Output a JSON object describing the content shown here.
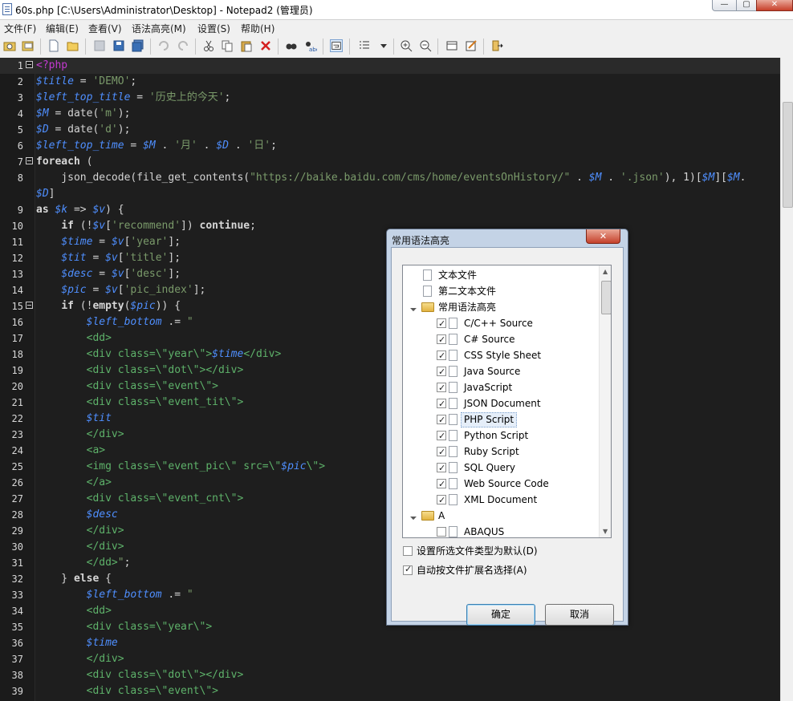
{
  "window": {
    "title": "60s.php [C:\\Users\\Administrator\\Desktop] - Notepad2 (管理员)",
    "min_glyph": "—",
    "max_glyph": "▢",
    "close_glyph": "✕"
  },
  "menu": [
    "文件(F)",
    "编辑(E)",
    "查看(V)",
    "语法高亮(M)",
    "设置(S)",
    "帮助(H)"
  ],
  "dialog": {
    "title": "常用语法高亮",
    "close_glyph": "✕",
    "tree": [
      {
        "label": "文本文件",
        "level": 0,
        "type": "doc"
      },
      {
        "label": "第二文本文件",
        "level": 0,
        "type": "doc"
      },
      {
        "label": "常用语法高亮",
        "level": 0,
        "type": "folder"
      },
      {
        "label": "C/C++ Source",
        "level": 1,
        "checked": true
      },
      {
        "label": "C# Source",
        "level": 1,
        "checked": true
      },
      {
        "label": "CSS Style Sheet",
        "level": 1,
        "checked": true
      },
      {
        "label": "Java Source",
        "level": 1,
        "checked": true
      },
      {
        "label": "JavaScript",
        "level": 1,
        "checked": true
      },
      {
        "label": "JSON Document",
        "level": 1,
        "checked": true
      },
      {
        "label": "PHP Script",
        "level": 1,
        "checked": true,
        "selected": true
      },
      {
        "label": "Python Script",
        "level": 1,
        "checked": true
      },
      {
        "label": "Ruby Script",
        "level": 1,
        "checked": true
      },
      {
        "label": "SQL Query",
        "level": 1,
        "checked": true
      },
      {
        "label": "Web Source Code",
        "level": 1,
        "checked": true
      },
      {
        "label": "XML Document",
        "level": 1,
        "checked": true
      },
      {
        "label": "A",
        "level": 0,
        "type": "folder"
      },
      {
        "label": "ABAQUS",
        "level": 1,
        "checked": false
      }
    ],
    "option_default": {
      "label": "设置所选文件类型为默认(D)",
      "checked": false
    },
    "option_auto": {
      "label": "自动按文件扩展名选择(A)",
      "checked": true
    },
    "ok_label": "确定",
    "cancel_label": "取消"
  },
  "code_lines": [
    {
      "n": "1",
      "html": "<span class='p'>&lt;?php</span>"
    },
    {
      "n": "2",
      "html": "<span class='v'>$title</span> = <span class='s'>'DEMO'</span>;"
    },
    {
      "n": "3",
      "html": "<span class='v'>$left_top_title</span> = <span class='s'>'历史上的今天'</span>;"
    },
    {
      "n": "4",
      "html": "<span class='v'>$M</span> = date(<span class='s'>'m'</span>);"
    },
    {
      "n": "5",
      "html": "<span class='v'>$D</span> = date(<span class='s'>'d'</span>);"
    },
    {
      "n": "6",
      "html": "<span class='v'>$left_top_time</span> = <span class='v'>$M</span> . <span class='s'>'月'</span> . <span class='v'>$D</span> . <span class='s'>'日'</span>;"
    },
    {
      "n": "7",
      "html": "<span class='k'>foreach</span> ("
    },
    {
      "n": "8",
      "html": "    json_decode(file_get_contents(<span class='s'>\"https://baike.baidu.com/cms/home/eventsOnHistory/\"</span> . <span class='v'>$M</span> . <span class='s'>'.json'</span>), 1)[<span class='v'>$M</span>][<span class='v'>$M</span>."
    },
    {
      "n": "",
      "html": "<span class='v'>$D</span>]"
    },
    {
      "n": "9",
      "html": "<span class='k'>as</span> <span class='v'>$k</span> =&gt; <span class='v'>$v</span>) {"
    },
    {
      "n": "10",
      "html": "    <span class='k'>if</span> (!<span class='v'>$v</span>[<span class='s'>'recommend'</span>]) <span class='k'>continue</span>;"
    },
    {
      "n": "11",
      "html": "    <span class='v'>$time</span> = <span class='v'>$v</span>[<span class='s'>'year'</span>];"
    },
    {
      "n": "12",
      "html": "    <span class='v'>$tit</span> = <span class='v'>$v</span>[<span class='s'>'title'</span>];"
    },
    {
      "n": "13",
      "html": "    <span class='v'>$desc</span> = <span class='v'>$v</span>[<span class='s'>'desc'</span>];"
    },
    {
      "n": "14",
      "html": "    <span class='v'>$pic</span> = <span class='v'>$v</span>[<span class='s'>'pic_index'</span>];"
    },
    {
      "n": "15",
      "html": "    <span class='k'>if</span> (!<span class='k'>empty</span>(<span class='v'>$pic</span>)) {"
    },
    {
      "n": "16",
      "html": "        <span class='v'>$left_bottom</span> .= <span class='s'>\"</span>"
    },
    {
      "n": "17",
      "html": "        <span class='h'>&lt;dd&gt;</span>"
    },
    {
      "n": "18",
      "html": "        <span class='h'>&lt;div class=\\\"year\\\"&gt;</span><span class='v'>$time</span><span class='h'>&lt;/div&gt;</span>"
    },
    {
      "n": "19",
      "html": "        <span class='h'>&lt;div class=\\\"dot\\\"&gt;&lt;/div&gt;</span>"
    },
    {
      "n": "20",
      "html": "        <span class='h'>&lt;div class=\\\"event\\\"&gt;</span>"
    },
    {
      "n": "21",
      "html": "        <span class='h'>&lt;div class=\\\"event_tit\\\"&gt;</span>"
    },
    {
      "n": "22",
      "html": "        <span class='v'>$tit</span>"
    },
    {
      "n": "23",
      "html": "        <span class='h'>&lt;/div&gt;</span>"
    },
    {
      "n": "24",
      "html": "        <span class='h'>&lt;a&gt;</span>"
    },
    {
      "n": "25",
      "html": "        <span class='h'>&lt;img class=\\\"event_pic\\\" src=\\\"</span><span class='v'>$pic</span><span class='h'>\\\"&gt;</span>"
    },
    {
      "n": "26",
      "html": "        <span class='h'>&lt;/a&gt;</span>"
    },
    {
      "n": "27",
      "html": "        <span class='h'>&lt;div class=\\\"event_cnt\\\"&gt;</span>"
    },
    {
      "n": "28",
      "html": "        <span class='v'>$desc</span>"
    },
    {
      "n": "29",
      "html": "        <span class='h'>&lt;/div&gt;</span>"
    },
    {
      "n": "30",
      "html": "        <span class='h'>&lt;/div&gt;</span>"
    },
    {
      "n": "31",
      "html": "        <span class='h'>&lt;/dd&gt;</span><span class='s'>\"</span>;"
    },
    {
      "n": "32",
      "html": "    } <span class='k'>else</span> {"
    },
    {
      "n": "33",
      "html": "        <span class='v'>$left_bottom</span> .= <span class='s'>\"</span>"
    },
    {
      "n": "34",
      "html": "        <span class='h'>&lt;dd&gt;</span>"
    },
    {
      "n": "35",
      "html": "        <span class='h'>&lt;div class=\\\"year\\\"&gt;</span>"
    },
    {
      "n": "36",
      "html": "        <span class='v'>$time</span>"
    },
    {
      "n": "37",
      "html": "        <span class='h'>&lt;/div&gt;</span>"
    },
    {
      "n": "38",
      "html": "        <span class='h'>&lt;div class=\\\"dot\\\"&gt;&lt;/div&gt;</span>"
    },
    {
      "n": "39",
      "html": "        <span class='h'>&lt;div class=\\\"event\\\"&gt;</span>"
    }
  ]
}
